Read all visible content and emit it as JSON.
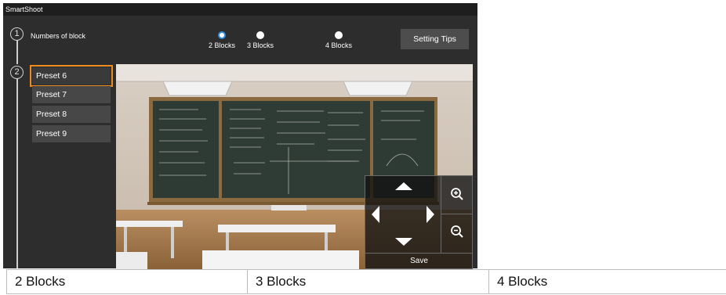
{
  "app": {
    "title": "SmartShoot"
  },
  "steps": {
    "one": "1",
    "two": "2"
  },
  "blocks": {
    "label": "Numbers of block",
    "options": [
      {
        "label": "2 Blocks",
        "selected": true
      },
      {
        "label": "3 Blocks",
        "selected": false
      },
      {
        "label": "4 Blocks",
        "selected": false
      }
    ]
  },
  "setting_tips_label": "Setting Tips",
  "presets": [
    {
      "label": "Preset 6",
      "active": true
    },
    {
      "label": "Preset 7",
      "active": false
    },
    {
      "label": "Preset 8",
      "active": false
    },
    {
      "label": "Preset 9",
      "active": false
    }
  ],
  "ptz": {
    "save_label": "Save",
    "icons": [
      "arrow-up-icon",
      "arrow-down-icon",
      "arrow-left-icon",
      "arrow-right-icon",
      "zoom-in-icon",
      "zoom-out-icon"
    ]
  },
  "camera_view": {
    "scene": "classroom-chalkboard"
  },
  "table": {
    "cells": [
      "2 Blocks",
      "3 Blocks",
      "4 Blocks"
    ]
  },
  "colors": {
    "accent": "#f08c1e",
    "radio_selected": "#2f8be0",
    "panel": "#2d2d2d",
    "titlebar": "#1e1e1e"
  }
}
